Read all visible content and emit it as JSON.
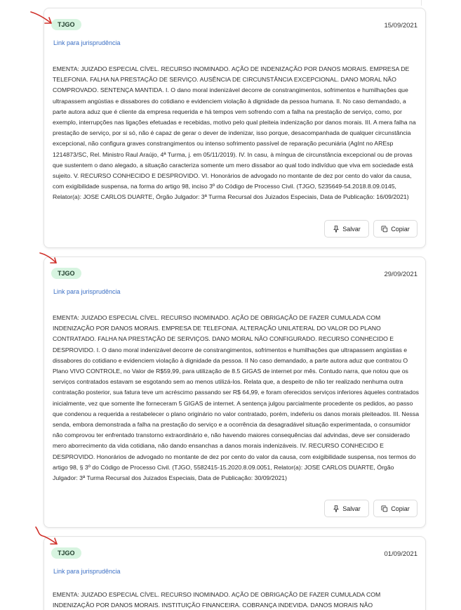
{
  "results": [
    {
      "court": "TJGO",
      "date": "15/09/2021",
      "link_label": "Link para jurisprudência",
      "ementa": "EMENTA: JUIZADO ESPECIAL CÍVEL. RECURSO INOMINADO. AÇÃO DE INDENIZAÇÃO POR DANOS MORAIS. EMPRESA DE TELEFONIA. FALHA NA PRESTAÇÃO DE SERVIÇO. AUSÊNCIA DE CIRCUNSTÂNCIA EXCEPCIONAL. DANO MORAL NÃO COMPROVADO. SENTENÇA MANTIDA. I. O dano moral indenizável decorre de constrangimentos, sofrimentos e humilhações que ultrapassem angústias e dissabores do cotidiano e evidenciem violação à dignidade da pessoa humana. II. No caso demandado, a parte autora aduz que é cliente da empresa requerida e há tempos vem sofrendo com a falha na prestação de serviço, como, por exemplo, interrupções nas ligações efetuadas e recebidas, motivo pelo qual pleiteia indenização por danos morais. III. A mera falha na prestação de serviço, por si só, não é capaz de gerar o dever de indenizar, isso porque, desacompanhada de qualquer circunstância excepcional, não configura graves constrangimentos ou intenso sofrimento passível de reparação pecuniária (AgInt no AREsp 1214873/SC, Rel. Ministro Raul Araújo, 4ª Turma, j. em 05/11/2019). IV. In casu, à míngua de circunstância excepcional ou de provas que sustentem o dano alegado, a situação caracteriza somente um mero dissabor ao qual todo indivíduo que viva em sociedade está sujeito. V. RECURSO CONHECIDO E DESPROVIDO. VI. Honorários de advogado no montante de dez por cento do valor da causa, com exigibilidade suspensa, na forma do artigo 98, inciso 3º do Código de Processo Civil. (TJGO, 5235649-54.2018.8.09.0145, Relator(a): JOSE CARLOS DUARTE, Órgão Julgador: 3ª Turma Recursal dos Juizados Especiais, Data de Publicação: 16/09/2021)",
      "save_label": "Salvar",
      "copy_label": "Copiar"
    },
    {
      "court": "TJGO",
      "date": "29/09/2021",
      "link_label": "Link para jurisprudência",
      "ementa": "EMENTA: JUIZADO ESPECIAL CÍVEL. RECURSO INOMINADO. AÇÃO DE OBRIGAÇÃO DE FAZER CUMULADA COM INDENIZAÇÃO POR DANOS MORAIS. EMPRESA DE TELEFONIA. ALTERAÇÃO UNILATERAL DO VALOR DO PLANO CONTRATADO. FALHA NA PRESTAÇÃO DE SERVIÇOS. DANO MORAL NÃO CONFIGURADO. RECURSO CONHECIDO E DESPROVIDO. I. O dano moral indenizável decorre de constrangimentos, sofrimentos e humilhações que ultrapassem angústias e dissabores do cotidiano e evidenciem violação à dignidade da pessoa. II No caso demandado, a parte autora aduz que contratou O Plano VIVO CONTROLE, no Valor de R$59,99, para utilização de 8.5 GIGAS de internet por mês. Contudo narra, que notou que os serviços contratados estavam se esgotando sem ao menos utilizá-los. Relata que, a despeito de não ter realizado nenhuma outra contratação posterior, sua fatura teve um acréscimo passando ser R$ 64,99, e foram oferecidos serviços inferiores àqueles contratados inicialmente, vez que somente lhe forneceram 5 GIGAS de internet. A sentença julgou parcialmente procedente os pedidos, ao passo que condenou a requerida a restabelecer o plano originário no valor contratado, porém, indeferiu os danos morais pleiteados. III. Nessa senda, embora demonstrada a falha na prestação do serviço e a ocorrência da desagradável situação experimentada, o consumidor não comprovou ter enfrentado transtorno extraordinário e, não havendo maiores consequências daí advindas, deve ser considerado mero aborrecimento da vida cotidiana, não dando ensanchas a danos morais indenizáveis. IV. RECURSO CONHECIDO E DESPROVIDO. Honorários de advogado no montante de dez por cento do valor da causa, com exigibilidade suspensa, nos termos do artigo 98, § 3º do Código de Processo Civil. (TJGO, 5582415-15.2020.8.09.0051, Relator(a): JOSE CARLOS DUARTE, Órgão Julgador: 3ª Turma Recursal dos Juizados Especiais, Data de Publicação: 30/09/2021)",
      "save_label": "Salvar",
      "copy_label": "Copiar"
    },
    {
      "court": "TJGO",
      "date": "01/09/2021",
      "link_label": "Link para jurisprudência",
      "ementa": "EMENTA: JUIZADO ESPECIAL CÍVEL. RECURSO INOMINADO. AÇÃO DE OBRIGAÇÃO DE FAZER CUMULADA COM INDENIZAÇÃO POR DANOS MORAIS. INSTITUIÇÃO FINANCEIRA. COBRANÇA INDEVIDA. DANOS MORAIS NÃO"
    }
  ],
  "annotation_color": "#d0302a",
  "badge_color": "#d7f4e0",
  "link_color": "#3b6fc4"
}
